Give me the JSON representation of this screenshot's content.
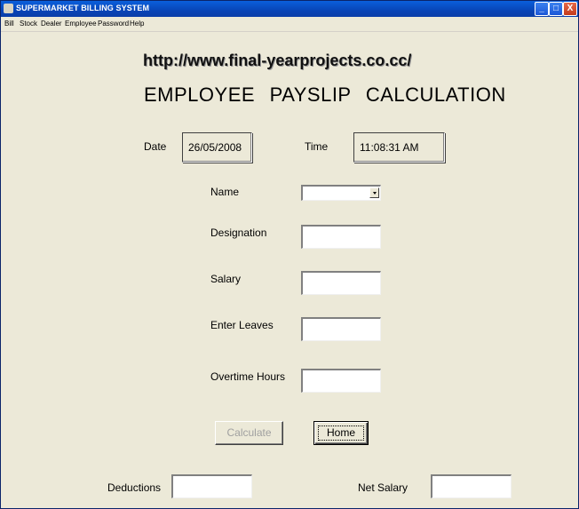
{
  "window": {
    "title": "SUPERMARKET BILLING SYSTEM",
    "controls": {
      "minimize": "_",
      "maximize": "□",
      "close": "X"
    }
  },
  "menu": [
    "Bill",
    "Stock",
    "Dealer",
    "Employee",
    "Password",
    "Help"
  ],
  "url_text": "http://www.final-yearprojects.co.cc/",
  "heading": "EMPLOYEE   PAYSLIP   CALCULATION",
  "date": {
    "label": "Date",
    "value": "26/05/2008"
  },
  "time": {
    "label": "Time",
    "value": "11:08:31 AM"
  },
  "form": {
    "name_label": "Name",
    "name_value": "",
    "designation_label": "Designation",
    "designation_value": "",
    "salary_label": "Salary",
    "salary_value": "",
    "leaves_label": "Enter Leaves",
    "leaves_value": "",
    "overtime_label": "Overtime Hours",
    "overtime_value": ""
  },
  "buttons": {
    "calculate": "Calculate",
    "home": "Home"
  },
  "results": {
    "deductions_label": "Deductions",
    "deductions_value": "",
    "net_salary_label": "Net Salary",
    "net_salary_value": ""
  },
  "icons": {
    "app": "app-icon",
    "combo": "chevron-down-icon"
  }
}
